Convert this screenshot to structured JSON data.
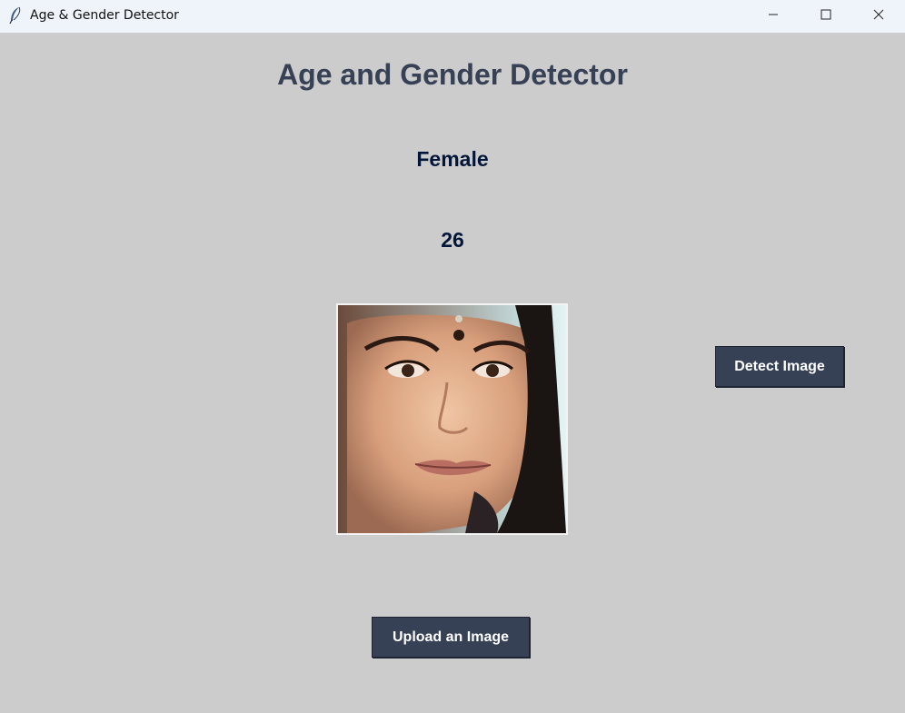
{
  "window": {
    "title": "Age & Gender Detector",
    "icon": "feather-icon"
  },
  "controls": {
    "minimize_icon": "minimize-icon",
    "maximize_icon": "maximize-icon",
    "close_icon": "close-icon"
  },
  "app": {
    "heading": "Age and Gender Detector",
    "gender": "Female",
    "age": "26",
    "detect_button": "Detect Image",
    "upload_button": "Upload an Image"
  },
  "colors": {
    "background": "#cccccc",
    "heading": "#364156",
    "result_text": "#011638",
    "button_bg": "#364156",
    "button_text": "#ffffff"
  }
}
